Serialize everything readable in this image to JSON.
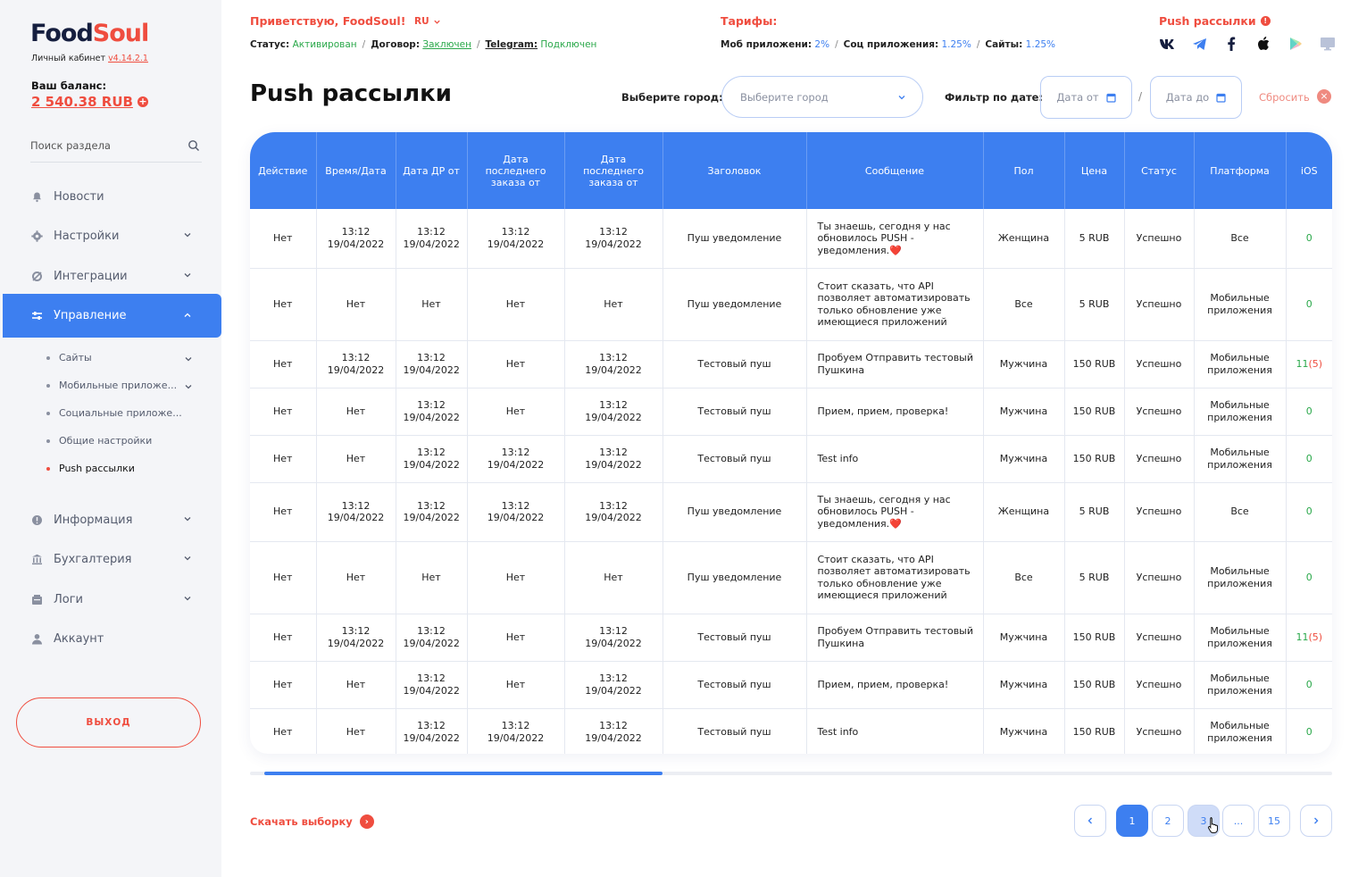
{
  "sidebar": {
    "logo_food": "Food",
    "logo_soul": "Soul",
    "cabinet_label": "Личный кабинет",
    "version": "v4.14.2.1",
    "balance_label": "Ваш баланс:",
    "balance_value": "2 540.38 RUB",
    "search_placeholder": "Поиск раздела",
    "nav": [
      {
        "label": "Новости",
        "icon": "bell-icon"
      },
      {
        "label": "Настройки",
        "icon": "gear-icon"
      },
      {
        "label": "Интеграции",
        "icon": "integrations-icon"
      },
      {
        "label": "Управление",
        "icon": "sliders-icon"
      },
      {
        "label": "Информация",
        "icon": "info-icon"
      },
      {
        "label": "Бухгалтерия",
        "icon": "bank-icon"
      },
      {
        "label": "Логи",
        "icon": "logs-icon"
      },
      {
        "label": "Аккаунт",
        "icon": "user-icon"
      }
    ],
    "sub_items": [
      "Сайты",
      "Мобильные приложе...",
      "Социальные приложе...",
      "Общие настройки",
      "Push рассылки"
    ],
    "logout_label": "ВЫХОД"
  },
  "header": {
    "greeting": "Приветствую, FoodSoul!",
    "lang": "RU",
    "status_label": "Статус:",
    "status_value": "Активирован",
    "contract_label": "Договор:",
    "contract_value": "Заключен",
    "telegram_label": "Telegram:",
    "telegram_value": "Подключен",
    "tariffs_title": "Тарифы:",
    "tariff_mob_label": "Моб приложени:",
    "tariff_mob_value": "2%",
    "tariff_soc_label": "Соц приложения:",
    "tariff_soc_value": "1.25%",
    "tariff_sites_label": "Сайты:",
    "tariff_sites_value": "1.25%",
    "push_title": "Push рассылки",
    "social_icons": [
      "vk-icon",
      "telegram-icon",
      "facebook-icon",
      "apple-icon",
      "google-play-icon",
      "desktop-icon"
    ]
  },
  "main": {
    "title": "Push рассылки",
    "city_label": "Выберите город:",
    "city_placeholder": "Выберите город",
    "date_filter_label": "Фильтр по дате:",
    "date_from": "Дата от",
    "date_to": "Дата до",
    "date_sep": "/",
    "reset_label": "Сбросить",
    "download_label": "Скачать выборку"
  },
  "table": {
    "columns": [
      "Действие",
      "Время/Дата",
      "Дата ДР от",
      "Дата последнего заказа от",
      "Дата последнего заказа от",
      "Заголовок",
      "Сообщение",
      "Пол",
      "Цена",
      "Статус",
      "Платформа",
      "iOS"
    ],
    "rows": [
      [
        "Нет",
        "13:12 19/04/2022",
        "13:12 19/04/2022",
        "13:12 19/04/2022",
        "13:12 19/04/2022",
        "Пуш уведомление",
        "Ты знаешь, сегодня у нас обновилось PUSH - уведомления.❤️",
        "Женщина",
        "5 RUB",
        "Успешно",
        "Все",
        "0",
        ""
      ],
      [
        "Нет",
        "Нет",
        "Нет",
        "Нет",
        "Нет",
        "Пуш уведомление",
        "Стоит сказать, что API позволяет автоматизировать только обновление уже имеющиеся приложений",
        "Все",
        "5 RUB",
        "Успешно",
        "Мобильные приложения",
        "0",
        ""
      ],
      [
        "Нет",
        "13:12 19/04/2022",
        "13:12 19/04/2022",
        "Нет",
        "13:12 19/04/2022",
        "Тестовый пуш",
        "Пробуем Отправить тестовый Пушкина",
        "Мужчина",
        "150 RUB",
        "Успешно",
        "Мобильные приложения",
        "11",
        "(5)"
      ],
      [
        "Нет",
        "Нет",
        "13:12 19/04/2022",
        "Нет",
        "13:12 19/04/2022",
        "Тестовый пуш",
        "Прием, прием, проверка!",
        "Мужчина",
        "150 RUB",
        "Успешно",
        "Мобильные приложения",
        "0",
        ""
      ],
      [
        "Нет",
        "Нет",
        "13:12 19/04/2022",
        "13:12 19/04/2022",
        "13:12 19/04/2022",
        "Тестовый пуш",
        "Test info",
        "Мужчина",
        "150 RUB",
        "Успешно",
        "Мобильные приложения",
        "0",
        ""
      ],
      [
        "Нет",
        "13:12 19/04/2022",
        "13:12 19/04/2022",
        "13:12 19/04/2022",
        "13:12 19/04/2022",
        "Пуш уведомление",
        "Ты знаешь, сегодня у нас обновилось PUSH - уведомления.❤️",
        "Женщина",
        "5 RUB",
        "Успешно",
        "Все",
        "0",
        ""
      ],
      [
        "Нет",
        "Нет",
        "Нет",
        "Нет",
        "Нет",
        "Пуш уведомление",
        "Стоит сказать, что API позволяет автоматизировать только обновление уже имеющиеся приложений",
        "Все",
        "5 RUB",
        "Успешно",
        "Мобильные приложения",
        "0",
        ""
      ],
      [
        "Нет",
        "13:12 19/04/2022",
        "13:12 19/04/2022",
        "Нет",
        "13:12 19/04/2022",
        "Тестовый пуш",
        "Пробуем Отправить тестовый Пушкина",
        "Мужчина",
        "150 RUB",
        "Успешно",
        "Мобильные приложения",
        "11",
        "(5)"
      ],
      [
        "Нет",
        "Нет",
        "13:12 19/04/2022",
        "Нет",
        "13:12 19/04/2022",
        "Тестовый пуш",
        "Прием, прием, проверка!",
        "Мужчина",
        "150 RUB",
        "Успешно",
        "Мобильные приложения",
        "0",
        ""
      ],
      [
        "Нет",
        "Нет",
        "13:12 19/04/2022",
        "13:12 19/04/2022",
        "13:12 19/04/2022",
        "Тестовый пуш",
        "Test info",
        "Мужчина",
        "150 RUB",
        "Успешно",
        "Мобильные приложения",
        "0",
        ""
      ]
    ]
  },
  "pagination": {
    "pages": [
      "1",
      "2",
      "3",
      "...",
      "15"
    ],
    "current": "1"
  },
  "colors": {
    "accent": "#3d7ff0",
    "brand": "#ef4d3f",
    "success": "#2aa84a"
  }
}
